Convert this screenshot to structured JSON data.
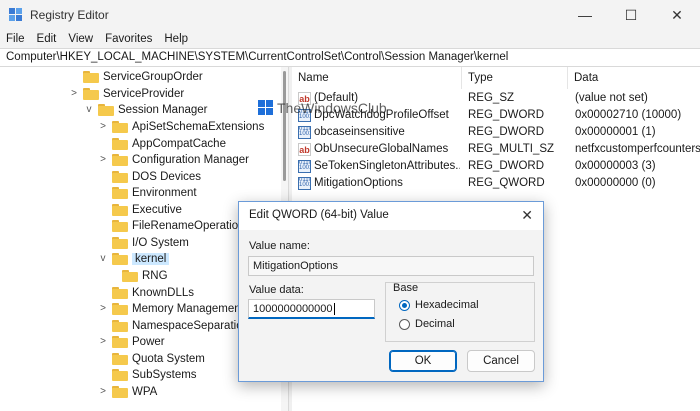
{
  "window": {
    "title": "Registry Editor",
    "controls": {
      "minimize": "—",
      "maximize": "☐",
      "close": "✕"
    }
  },
  "menu": [
    "File",
    "Edit",
    "View",
    "Favorites",
    "Help"
  ],
  "address": "Computer\\HKEY_LOCAL_MACHINE\\SYSTEM\\CurrentControlSet\\Control\\Session Manager\\kernel",
  "tree": {
    "items": [
      {
        "label": "ServiceGroupOrder",
        "chevron": ""
      },
      {
        "label": "ServiceProvider",
        "chevron": ">"
      },
      {
        "label": "Session Manager",
        "chevron": "v"
      },
      {
        "label": "ApiSetSchemaExtensions",
        "chevron": ">"
      },
      {
        "label": "AppCompatCache",
        "chevron": ""
      },
      {
        "label": "Configuration Manager",
        "chevron": ">"
      },
      {
        "label": "DOS Devices",
        "chevron": ""
      },
      {
        "label": "Environment",
        "chevron": ""
      },
      {
        "label": "Executive",
        "chevron": ""
      },
      {
        "label": "FileRenameOperations",
        "chevron": ""
      },
      {
        "label": "I/O System",
        "chevron": ""
      },
      {
        "label": "kernel",
        "chevron": "v"
      },
      {
        "label": "RNG",
        "chevron": ""
      },
      {
        "label": "KnownDLLs",
        "chevron": ""
      },
      {
        "label": "Memory Management",
        "chevron": ">"
      },
      {
        "label": "NamespaceSeparation",
        "chevron": ""
      },
      {
        "label": "Power",
        "chevron": ">"
      },
      {
        "label": "Quota System",
        "chevron": ""
      },
      {
        "label": "SubSystems",
        "chevron": ""
      },
      {
        "label": "WPA",
        "chevron": ">"
      }
    ]
  },
  "values": {
    "columns": [
      "Name",
      "Type",
      "Data"
    ],
    "rows": [
      {
        "icon": "string-value-icon",
        "name": "(Default)",
        "type": "REG_SZ",
        "data": "(value not set)"
      },
      {
        "icon": "binary-value-icon",
        "name": "DpcWatchdogProfileOffset",
        "type": "REG_DWORD",
        "data": "0x00002710 (10000)"
      },
      {
        "icon": "binary-value-icon",
        "name": "obcaseinsensitive",
        "type": "REG_DWORD",
        "data": "0x00000001 (1)"
      },
      {
        "icon": "string-value-icon",
        "name": "ObUnsecureGlobalNames",
        "type": "REG_MULTI_SZ",
        "data": "netfxcustomperfcounters"
      },
      {
        "icon": "binary-value-icon",
        "name": "SeTokenSingletonAttributes...",
        "type": "REG_DWORD",
        "data": "0x00000003 (3)"
      },
      {
        "icon": "binary-value-icon",
        "name": "MitigationOptions",
        "type": "REG_QWORD",
        "data": "0x00000000 (0)"
      }
    ]
  },
  "watermark": "TheWindowsClub",
  "dialog": {
    "title": "Edit QWORD (64-bit) Value",
    "close": "✕",
    "value_name_label": "Value name:",
    "value_name": "MitigationOptions",
    "value_data_label": "Value data:",
    "value_data": "1000000000000",
    "base_label": "Base",
    "hex_label": "Hexadecimal",
    "dec_label": "Decimal",
    "ok_label": "OK",
    "cancel_label": "Cancel"
  }
}
